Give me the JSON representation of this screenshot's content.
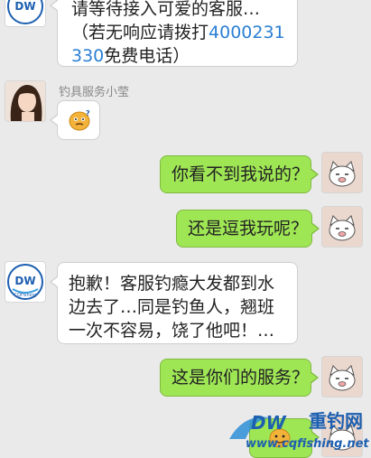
{
  "conversation": {
    "messages": [
      {
        "id": "m1",
        "side": "left",
        "text_before": "请等待接入可爱的客服…（若无响应请拨打",
        "phone": "4000231330",
        "text_after": "免费电话）"
      },
      {
        "id": "m2",
        "side": "left",
        "sender": "钓具服务小莹",
        "content": "emoji"
      },
      {
        "id": "m3",
        "side": "right",
        "text": "你看不到我说的？"
      },
      {
        "id": "m4",
        "side": "right",
        "text": "还是逗我玩呢？"
      },
      {
        "id": "m5",
        "side": "left",
        "text": "抱歉！客服钓瘾大发都到水边去了…同是钓鱼人，翘班一次不容易，饶了他吧！…"
      },
      {
        "id": "m6",
        "side": "right",
        "text": "这是你们的服务？"
      }
    ]
  },
  "watermark": {
    "brand_cn": "重钓网",
    "url": "www.cqfishing.net",
    "logo_letters": "DW"
  },
  "logo": {
    "letters": "DW",
    "sub": "CQFishing"
  },
  "colors": {
    "sent_bubble": "#9fe655",
    "received_bubble": "#ffffff",
    "background": "#eaeaea",
    "link": "#2a7fd4"
  }
}
